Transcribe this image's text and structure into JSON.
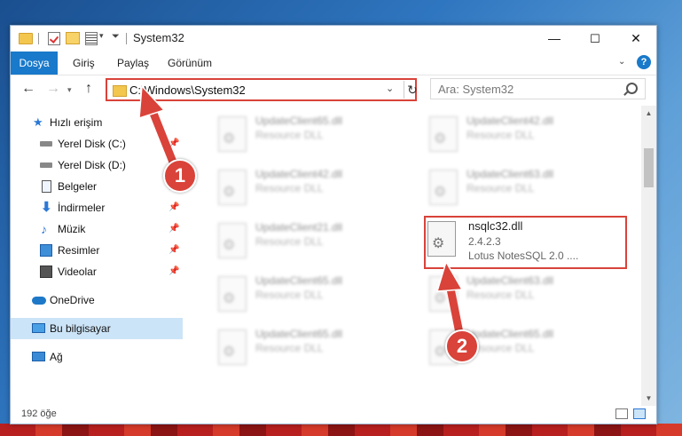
{
  "window": {
    "title": "System32",
    "controls": {
      "minimize": "—",
      "maximize": "☐",
      "close": "✕"
    }
  },
  "ribbon": {
    "tabs": [
      "Dosya",
      "Giriş",
      "Paylaş",
      "Görünüm"
    ],
    "help": "?"
  },
  "address": {
    "path": "C:\\Windows\\System32",
    "search_placeholder": "Ara: System32"
  },
  "sidebar": {
    "items": [
      {
        "label": "Hızlı erişim",
        "icon": "star-icon"
      },
      {
        "label": "Yerel Disk (C:)",
        "icon": "disk-icon"
      },
      {
        "label": "Yerel Disk (D:)",
        "icon": "disk-icon"
      },
      {
        "label": "Belgeler",
        "icon": "documents-icon"
      },
      {
        "label": "İndirmeler",
        "icon": "downloads-icon"
      },
      {
        "label": "Müzik",
        "icon": "music-icon"
      },
      {
        "label": "Resimler",
        "icon": "pictures-icon"
      },
      {
        "label": "Videolar",
        "icon": "videos-icon"
      },
      {
        "label": "OneDrive",
        "icon": "onedrive-icon"
      },
      {
        "label": "Bu bilgisayar",
        "icon": "this-pc-icon"
      },
      {
        "label": "Ağ",
        "icon": "network-icon"
      }
    ]
  },
  "files": [
    {
      "name": "UpdateClient65.dll",
      "type": "Resource DLL"
    },
    {
      "name": "UpdateClient42.dll",
      "type": "Resource DLL"
    },
    {
      "name": "UpdateClient42.dll",
      "type": "Resource DLL"
    },
    {
      "name": "UpdateClient63.dll",
      "type": "Resource DLL"
    },
    {
      "name": "UpdateClient21.dll",
      "type": "Resource DLL"
    },
    {
      "name": "UpdateClient65.dll",
      "type": "Resource DLL"
    },
    {
      "name": "UpdateClient63.dll",
      "type": "Resource DLL"
    },
    {
      "name": "UpdateClient65.dll",
      "type": "Resource DLL"
    },
    {
      "name": "UpdateClient65.dll",
      "type": "Resource DLL"
    }
  ],
  "selected_file": {
    "name": "nsqlc32.dll",
    "version": "2.4.2.3",
    "description": "Lotus NotesSQL 2.0 ...."
  },
  "status": {
    "count": "192 öğe"
  },
  "annotations": {
    "step1": "1",
    "step2": "2"
  },
  "colors": {
    "accent": "#1979ca",
    "highlight": "#d9433a",
    "selection": "#cce4f7"
  }
}
